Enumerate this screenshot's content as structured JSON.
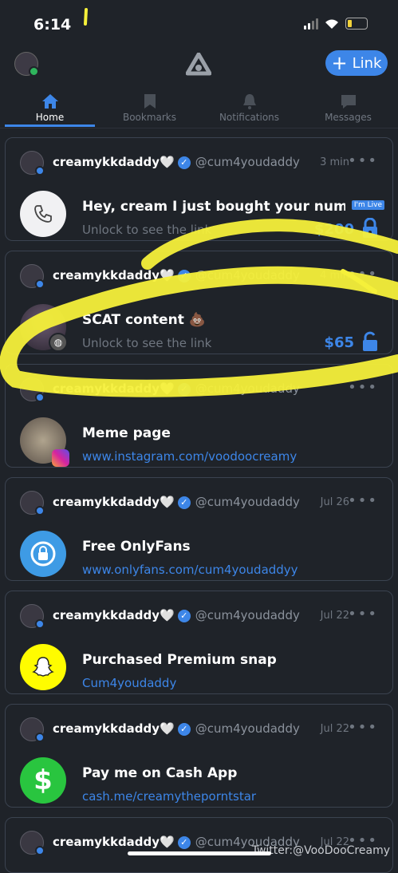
{
  "status": {
    "time": "6:14"
  },
  "header": {
    "link_label": "Link"
  },
  "tabs": [
    {
      "label": "Home",
      "icon": "home-icon"
    },
    {
      "label": "Bookmarks",
      "icon": "bookmark-icon"
    },
    {
      "label": "Notifications",
      "icon": "bell-icon"
    },
    {
      "label": "Messages",
      "icon": "message-icon"
    }
  ],
  "cards": [
    {
      "user": "creamykkdaddy🤍",
      "handle": "@cum4youdaddy",
      "time": "3 min",
      "title": "Hey, cream I just bought your numb...",
      "sub": "Unlock to see the link",
      "price": "$200",
      "badge": "I'm Live",
      "thumb": "phone-icon"
    },
    {
      "user": "creamykkdaddy🤍",
      "handle": "@cum4youdaddy",
      "time": "4 min",
      "title": "SCAT content 💩",
      "sub": "Unlock to see the link",
      "price": "$65",
      "thumb": "profile-photo"
    },
    {
      "user": "creamykkdaddy🤍",
      "handle": "@cum4youdaddy",
      "time": "",
      "title": "Meme page",
      "sub": "www.instagram.com/voodoocreamy",
      "thumb": "instagram-photo"
    },
    {
      "user": "creamykkdaddy🤍",
      "handle": "@cum4youdaddy",
      "time": "Jul 26",
      "title": "Free OnlyFans",
      "sub": "www.onlyfans.com/cum4youdaddyy",
      "thumb": "onlyfans-icon"
    },
    {
      "user": "creamykkdaddy🤍",
      "handle": "@cum4youdaddy",
      "time": "Jul 22",
      "title": "Purchased Premium snap",
      "sub": "Cum4youdaddy",
      "thumb": "snapchat-icon"
    },
    {
      "user": "creamykkdaddy🤍",
      "handle": "@cum4youdaddy",
      "time": "Jul 22",
      "title": "Pay me on Cash App",
      "sub": "cash.me/creamytheporntstar",
      "thumb": "cashapp-icon"
    },
    {
      "user": "creamykkdaddy🤍",
      "handle": "@cum4youdaddy",
      "time": "Jul 22"
    }
  ],
  "watermark": "Twitter:@VooDooCreamy",
  "colors": {
    "accent": "#3d86e8",
    "background": "#1f2329",
    "highlight": "#f5f03a"
  }
}
